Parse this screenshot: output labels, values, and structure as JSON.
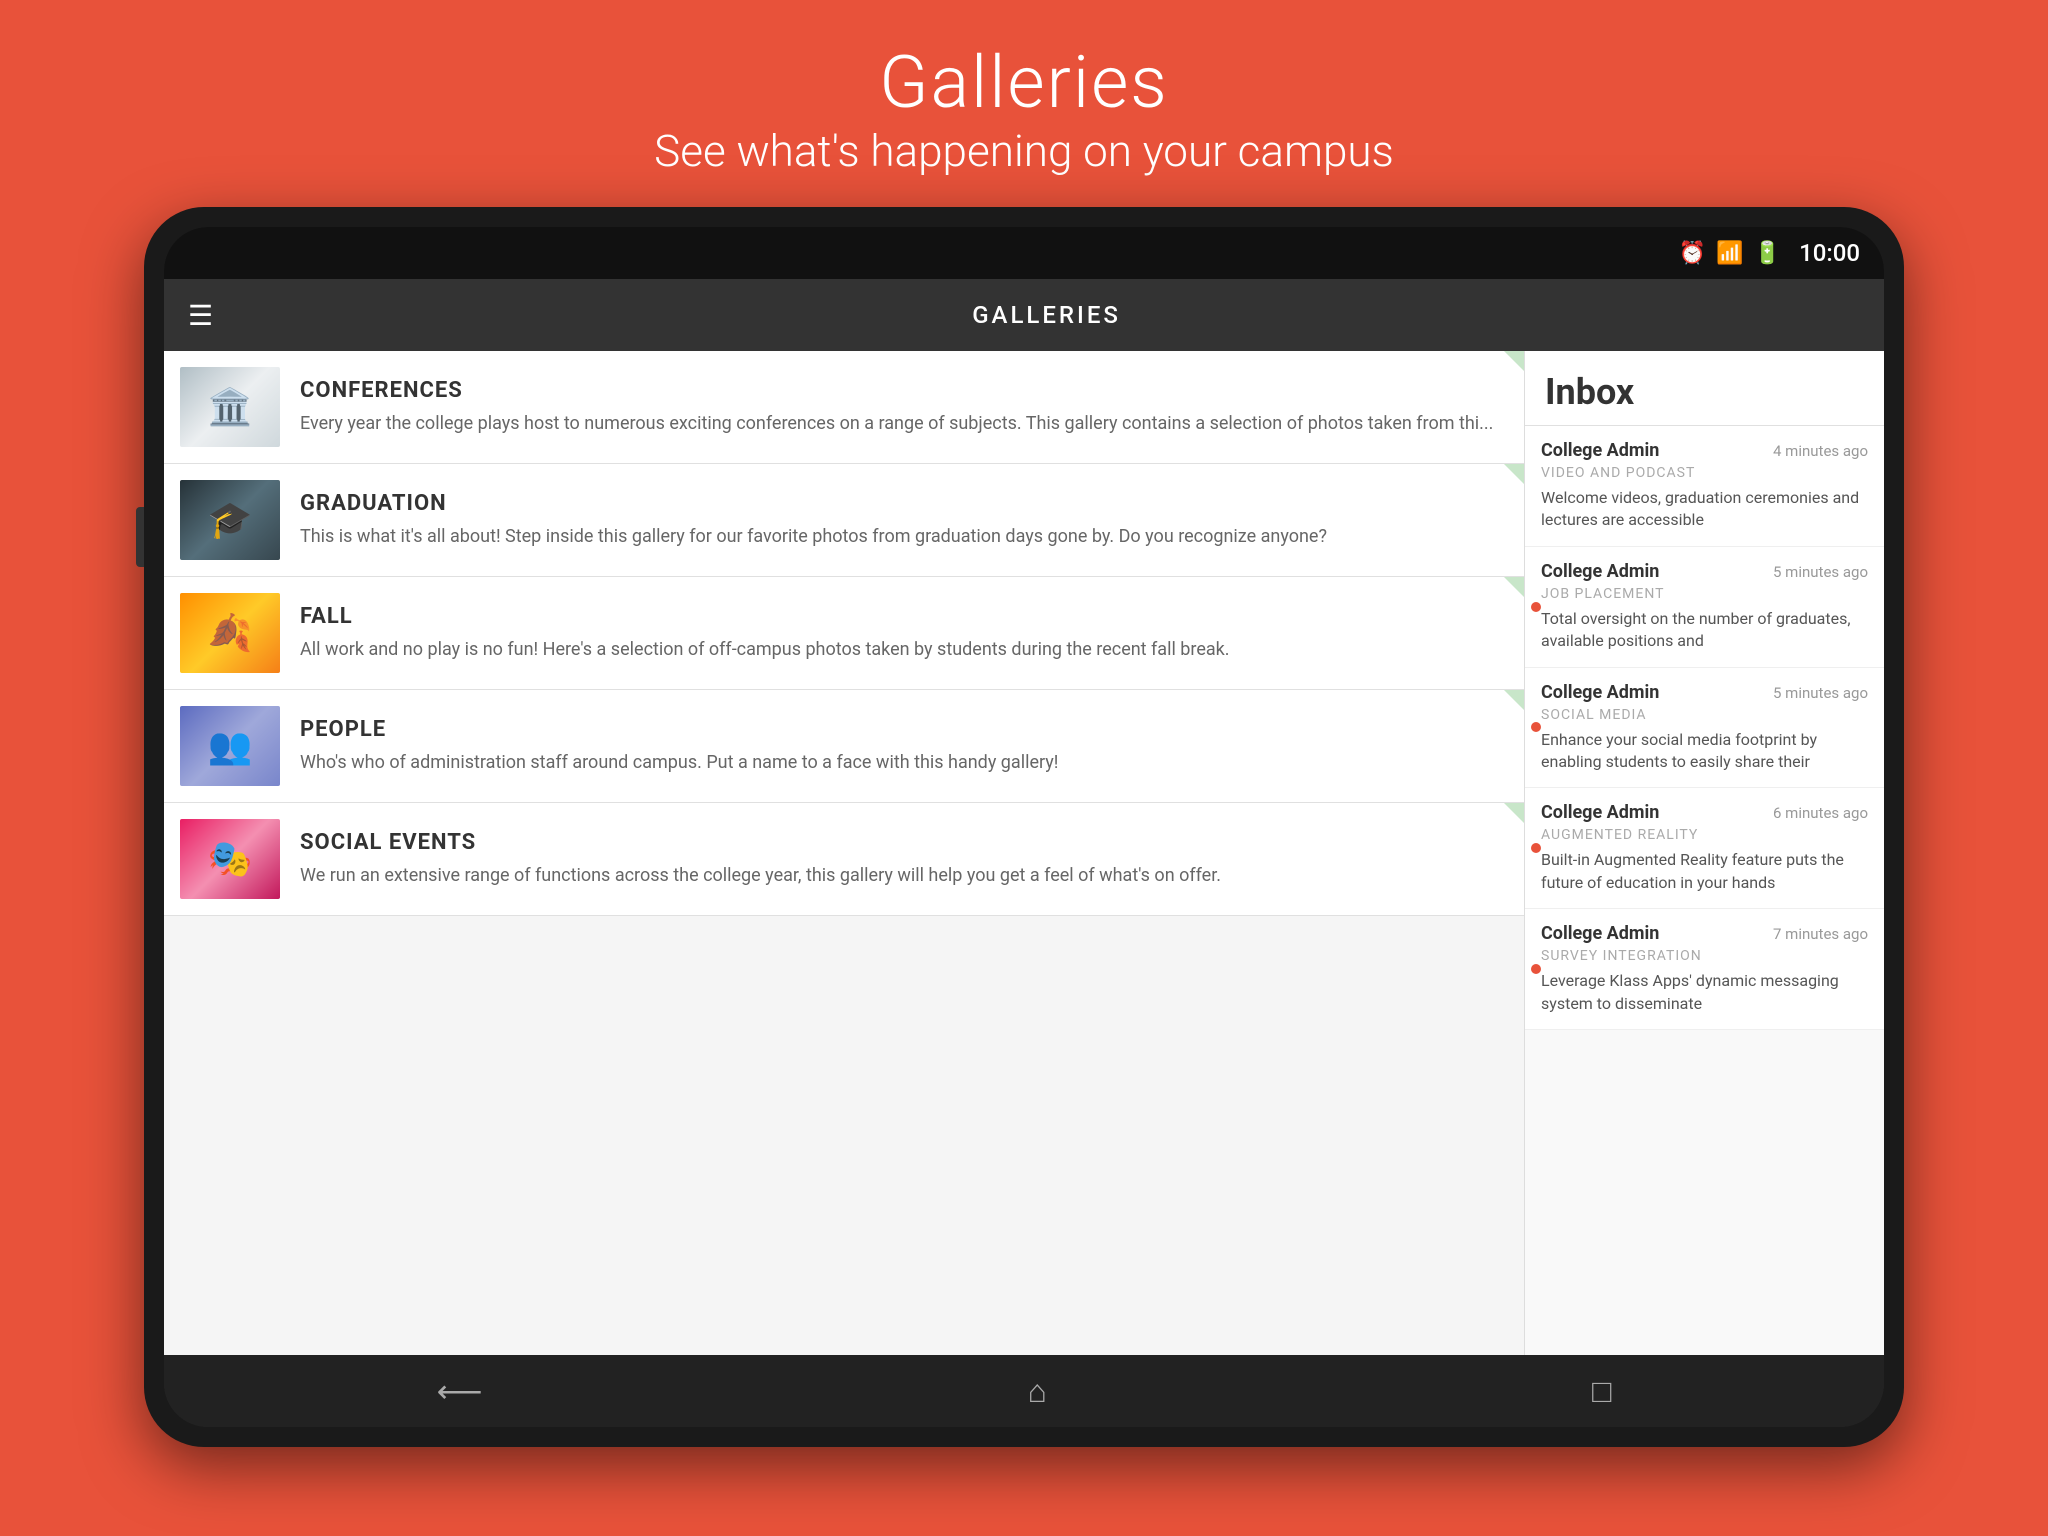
{
  "page": {
    "title": "Galleries",
    "subtitle": "See what's happening on your campus"
  },
  "status_bar": {
    "time": "10:00"
  },
  "app_bar": {
    "title": "GALLERIES"
  },
  "gallery_items": [
    {
      "id": "conferences",
      "title": "CONFERENCES",
      "description": "Every year the college plays host to numerous exciting conferences on a range of subjects.  This gallery contains a selection of photos taken from thi...",
      "emoji": "🏛️"
    },
    {
      "id": "graduation",
      "title": "GRADUATION",
      "description": "This is what it's all about!  Step inside this gallery for our favorite photos from graduation days gone by.  Do you recognize anyone?",
      "emoji": "🎓"
    },
    {
      "id": "fall",
      "title": "FALL",
      "description": "All work and no play is no fun!  Here's a selection of off-campus photos taken by students during the recent fall break.",
      "emoji": "🍂"
    },
    {
      "id": "people",
      "title": "PEOPLE",
      "description": "Who's who of administration staff around campus.  Put a name to a face with this handy gallery!",
      "emoji": "👥"
    },
    {
      "id": "social",
      "title": "SOCIAL EVENTS",
      "description": "We run an extensive range of functions across the college year, this gallery will help you get a feel of what's on offer.",
      "emoji": "🎭"
    }
  ],
  "inbox": {
    "title": "Inbox",
    "messages": [
      {
        "sender": "College Admin",
        "time": "4 minutes ago",
        "category": "VIDEO AND PODCAST",
        "preview": "Welcome videos, graduation ceremonies and lectures are accessible",
        "unread": false
      },
      {
        "sender": "College Admin",
        "time": "5 minutes ago",
        "category": "JOB PLACEMENT",
        "preview": "Total oversight on the number of graduates, available positions and",
        "unread": true
      },
      {
        "sender": "College Admin",
        "time": "5 minutes ago",
        "category": "SOCIAL MEDIA",
        "preview": "Enhance your social media footprint by enabling students to easily share their",
        "unread": true
      },
      {
        "sender": "College Admin",
        "time": "6 minutes ago",
        "category": "AUGMENTED REALITY",
        "preview": "Built-in Augmented Reality feature puts the future of education in your hands",
        "unread": true
      },
      {
        "sender": "College Admin",
        "time": "7 minutes ago",
        "category": "SURVEY INTEGRATION",
        "preview": "Leverage Klass Apps' dynamic messaging system to disseminate",
        "unread": true
      }
    ]
  },
  "nav": {
    "back": "⟵",
    "home": "⌂",
    "recents": "⬜"
  }
}
